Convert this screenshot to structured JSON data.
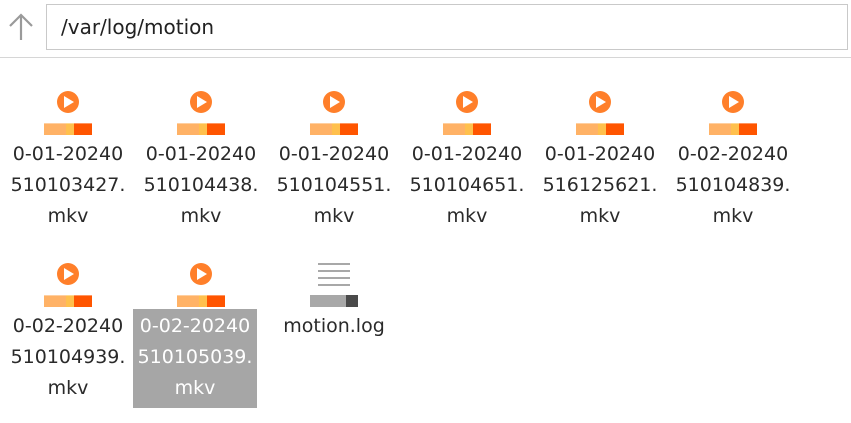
{
  "toolbar": {
    "up_icon": "arrow-up-icon",
    "path_value": "/var/log/motion",
    "path_placeholder": ""
  },
  "colors": {
    "video_accent": "#ff7f2a",
    "video_light": "#ffb266",
    "video_dark": "#ff5500",
    "log_gray": "#a8a8a8",
    "log_dark": "#4a4a4a",
    "selection": "#a6a6a6"
  },
  "files": [
    {
      "type": "video",
      "icon": "video-file-icon",
      "name": "0-01-20240\n510103427.\nmkv",
      "selected": false
    },
    {
      "type": "video",
      "icon": "video-file-icon",
      "name": "0-01-20240\n510104438.\nmkv",
      "selected": false
    },
    {
      "type": "video",
      "icon": "video-file-icon",
      "name": "0-01-20240\n510104551.\nmkv",
      "selected": false
    },
    {
      "type": "video",
      "icon": "video-file-icon",
      "name": "0-01-20240\n510104651.\nmkv",
      "selected": false
    },
    {
      "type": "video",
      "icon": "video-file-icon",
      "name": "0-01-20240\n516125621.\nmkv",
      "selected": false
    },
    {
      "type": "video",
      "icon": "video-file-icon",
      "name": "0-02-20240\n510104839.\nmkv",
      "selected": false
    },
    {
      "type": "video",
      "icon": "video-file-icon",
      "name": "0-02-20240\n510104939.\nmkv",
      "selected": false
    },
    {
      "type": "video",
      "icon": "video-file-icon",
      "name": "0-02-20240\n510105039.\nmkv",
      "selected": true
    },
    {
      "type": "log",
      "icon": "text-file-icon",
      "name": "motion.log",
      "selected": false
    }
  ]
}
